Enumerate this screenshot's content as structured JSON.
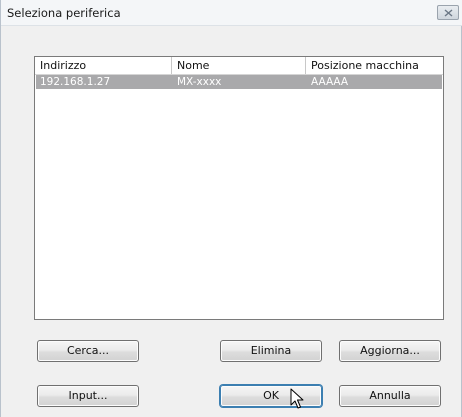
{
  "window": {
    "title": "Seleziona periferica"
  },
  "device_list": {
    "columns": [
      "Indirizzo",
      "Nome",
      "Posizione macchina"
    ],
    "rows": [
      {
        "address": "192.168.1.27",
        "name": "MX-xxxx",
        "location": "AAAAA",
        "selected": true
      }
    ]
  },
  "buttons": {
    "search": "Cerca...",
    "delete": "Elimina",
    "update": "Aggiorna...",
    "input": "Input...",
    "ok": "OK",
    "cancel": "Annulla"
  }
}
